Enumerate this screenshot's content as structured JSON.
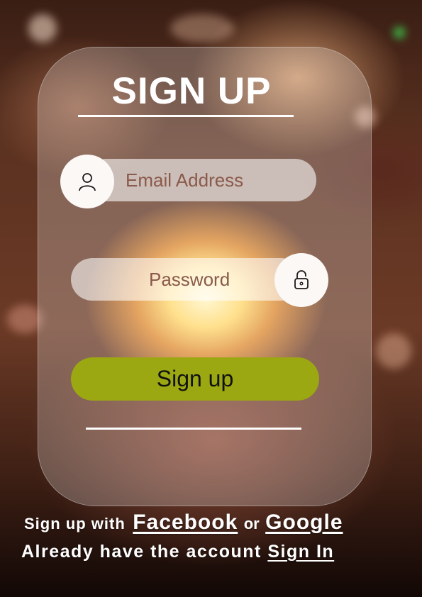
{
  "form": {
    "title": "SIGN UP",
    "email_placeholder": "Email Address",
    "password_placeholder": "Password",
    "submit_label": "Sign up"
  },
  "social": {
    "prefix": "Sign up with",
    "facebook_label": "Facebook",
    "separator": "or",
    "google_label": "Google"
  },
  "signin": {
    "prompt": "Already have the account",
    "link_label": "Sign In"
  },
  "icons": {
    "email": "user-icon",
    "password": "unlock-icon"
  },
  "colors": {
    "button": "#9ba812",
    "field_text": "#8a5a4a"
  }
}
